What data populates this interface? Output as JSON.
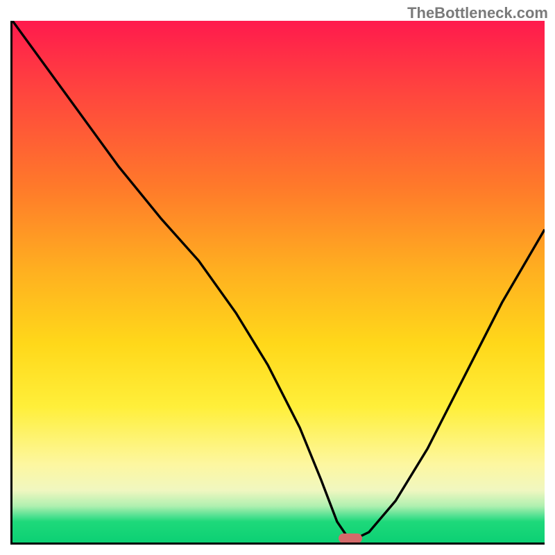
{
  "watermark": "TheBottleneck.com",
  "colors": {
    "gradient_top": "#ff1a4d",
    "gradient_mid": "#ffd81a",
    "gradient_bottom": "#0cd074",
    "curve": "#000000",
    "marker": "#d46a6a",
    "axis": "#000000"
  },
  "chart_data": {
    "type": "line",
    "title": "",
    "xlabel": "",
    "ylabel": "",
    "xlim": [
      0,
      100
    ],
    "ylim": [
      0,
      100
    ],
    "grid": false,
    "legend": false,
    "note": "roughly a V-shaped curve descending from top-left to a minimum near x≈63, then rising toward the right; y readings are approximate from the image since there are no tick labels",
    "series": [
      {
        "name": "curve",
        "x": [
          0,
          10,
          20,
          28,
          35,
          42,
          48,
          54,
          58,
          61,
          63,
          65,
          67,
          72,
          78,
          85,
          92,
          100
        ],
        "y": [
          100,
          86,
          72,
          62,
          54,
          44,
          34,
          22,
          12,
          4,
          1,
          1,
          2,
          8,
          18,
          32,
          46,
          60
        ]
      }
    ],
    "marker": {
      "x": 63.5,
      "y": 0.5
    },
    "background": "vertical gradient red→yellow→green indicating bottleneck severity (red = high, green = low)"
  }
}
